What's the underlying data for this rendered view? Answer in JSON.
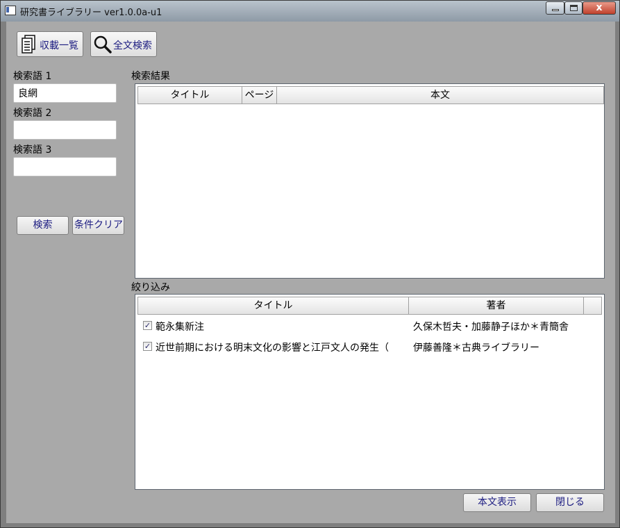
{
  "window": {
    "title": "研究書ライブラリー ver1.0.0a-u1",
    "close_glyph": "x"
  },
  "toolbar": {
    "list_label": "収載一覧",
    "fulltext_label": "全文検索"
  },
  "search": {
    "term1_label": "検索語 1",
    "term1_value": "良網",
    "term2_label": "検索語 2",
    "term2_value": "",
    "term3_label": "検索語 3",
    "term3_value": "",
    "search_button": "検索",
    "clear_button": "条件クリア"
  },
  "results": {
    "section_label": "検索結果",
    "columns": [
      "タイトル",
      "ページ",
      "本文"
    ]
  },
  "filter": {
    "section_label": "絞り込み",
    "columns": [
      "タイトル",
      "著者"
    ],
    "rows": [
      {
        "checked": true,
        "title": "範永集新注",
        "author": "久保木哲夫・加藤静子ほか＊青簡舎"
      },
      {
        "checked": true,
        "title": "近世前期における明末文化の影響と江戸文人の発生（",
        "author": "伊藤善隆＊古典ライブラリー"
      }
    ]
  },
  "footer": {
    "show_text_button": "本文表示",
    "close_button": "閉じる"
  }
}
